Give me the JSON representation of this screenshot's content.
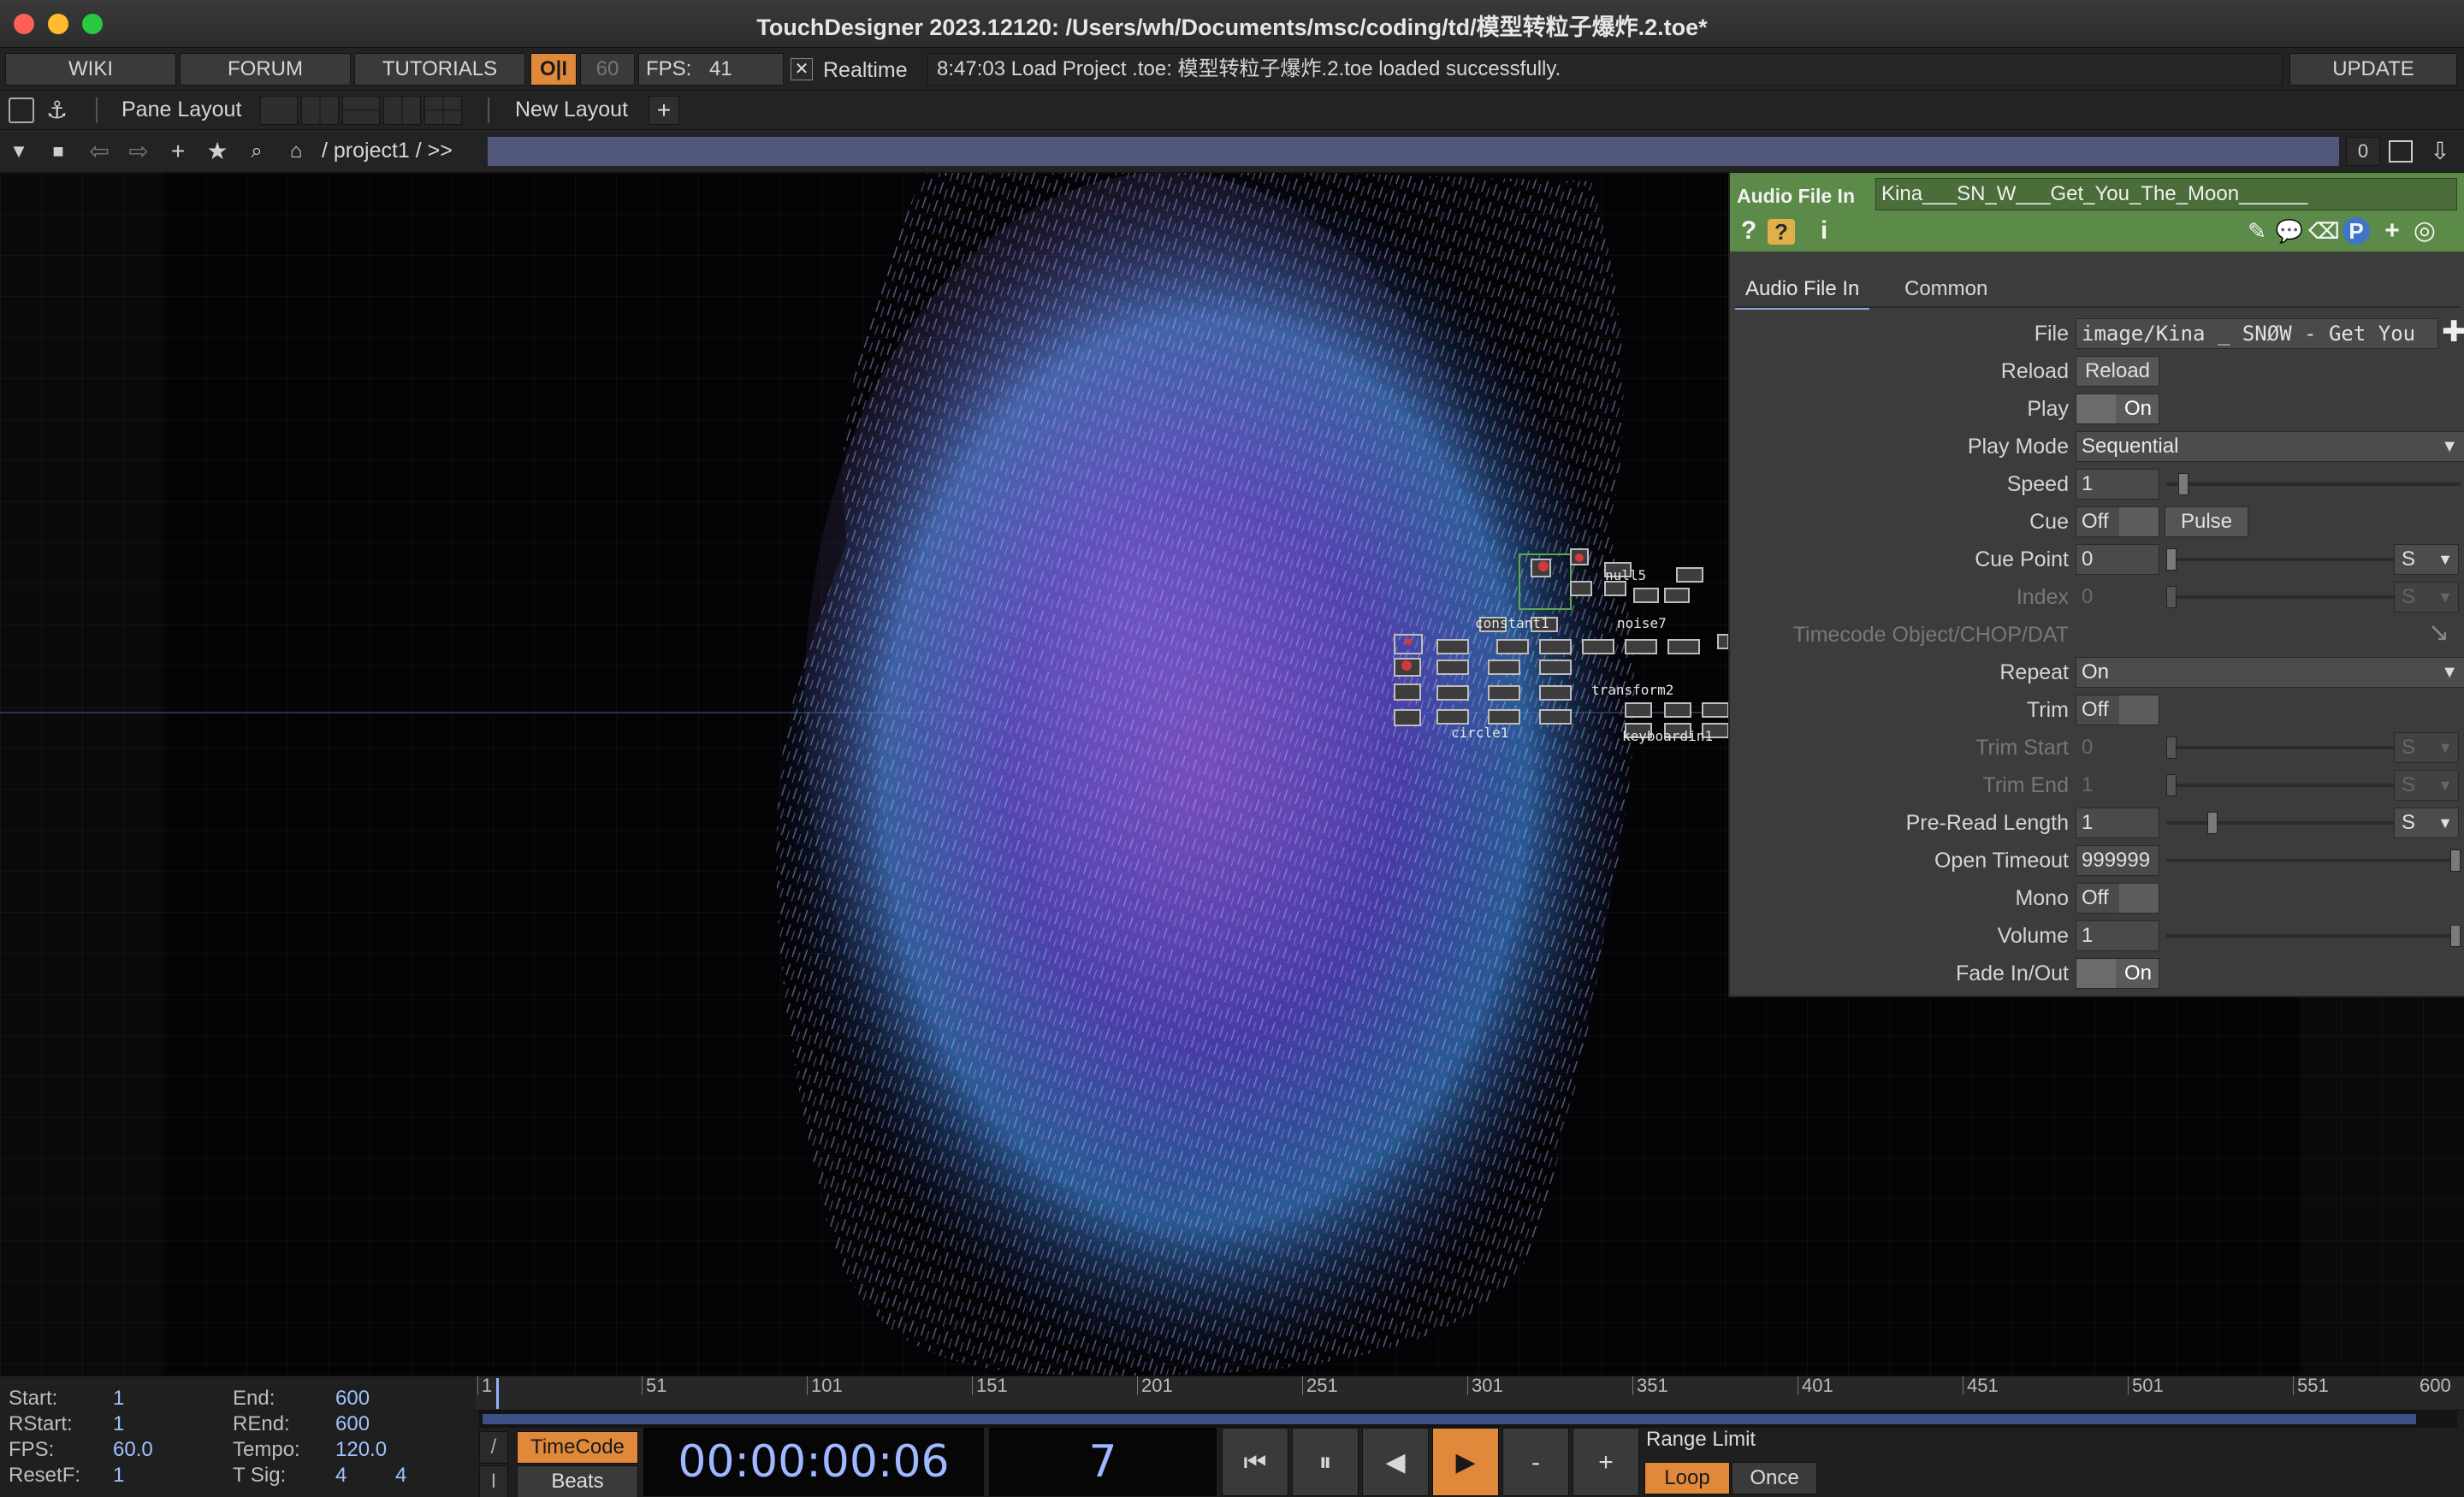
{
  "window": {
    "title": "TouchDesigner 2023.12120: /Users/wh/Documents/msc/coding/td/模型转粒子爆炸.2.toe*"
  },
  "menubar": {
    "wiki": "WIKI",
    "forum": "FORUM",
    "tutorials": "TUTORIALS",
    "oi_badge": "O|I",
    "fps_target": "60",
    "fps_label": "FPS:",
    "fps_value": "41",
    "realtime_check": "✕",
    "realtime_label": "Realtime",
    "status": "8:47:03 Load Project .toe: 模型转粒子爆炸.2.toe loaded successfully.",
    "update": "UPDATE"
  },
  "layoutbar": {
    "pane_layout": "Pane Layout",
    "new_layout": "New Layout",
    "add": "+"
  },
  "pathbar": {
    "path": "/ project1 / >>",
    "counter": "0"
  },
  "params": {
    "op_type": "Audio File In",
    "op_name": "Kina___SN_W___Get_You_The_Moon______",
    "tabs": [
      "Audio File In",
      "Common"
    ],
    "rows": {
      "file_label": "File",
      "file_value": "image/Kina _ SNØW - Get You",
      "reload_label": "Reload",
      "reload_btn": "Reload",
      "play_label": "Play",
      "play_value": "On",
      "playmode_label": "Play Mode",
      "playmode_value": "Sequential",
      "speed_label": "Speed",
      "speed_value": "1",
      "cue_label": "Cue",
      "cue_value": "Off",
      "pulse_btn": "Pulse",
      "cuepoint_label": "Cue Point",
      "cuepoint_value": "0",
      "cuepoint_unit": "S",
      "index_label": "Index",
      "index_value": "0",
      "index_unit": "S",
      "timecode_label": "Timecode Object/CHOP/DAT",
      "repeat_label": "Repeat",
      "repeat_value": "On",
      "trim_label": "Trim",
      "trim_value": "Off",
      "trimstart_label": "Trim Start",
      "trimstart_value": "0",
      "trimstart_unit": "S",
      "trimend_label": "Trim End",
      "trimend_value": "1",
      "trimend_unit": "S",
      "preread_label": "Pre-Read Length",
      "preread_value": "1",
      "preread_unit": "S",
      "timeout_label": "Open Timeout",
      "timeout_value": "999999",
      "mono_label": "Mono",
      "mono_value": "Off",
      "volume_label": "Volume",
      "volume_value": "1",
      "fade_label": "Fade In/Out",
      "fade_value": "On"
    }
  },
  "network_overlay": {
    "labels": [
      "constant1",
      "noise7",
      "transform2",
      "keyboardin1",
      "null5",
      "circle1"
    ]
  },
  "timeline": {
    "start_label": "Start:",
    "start": "1",
    "end_label": "End:",
    "end": "600",
    "rstart_label": "RStart:",
    "rstart": "1",
    "rend_label": "REnd:",
    "rend": "600",
    "fps_label": "FPS:",
    "fps": "60.0",
    "tempo_label": "Tempo:",
    "tempo": "120.0",
    "resetf_label": "ResetF:",
    "resetf": "1",
    "tsig_label": "T Sig:",
    "tsig_a": "4",
    "tsig_b": "4",
    "ticks": [
      "1",
      "51",
      "101",
      "151",
      "201",
      "251",
      "301",
      "351",
      "401",
      "451",
      "501",
      "551",
      "600"
    ],
    "timecode_btn": "TimeCode",
    "beats_btn": "Beats",
    "timecode": "00:00:00:06",
    "frame": "7",
    "range_limit": "Range Limit",
    "loop": "Loop",
    "once": "Once",
    "minus": "-",
    "plus": "+"
  },
  "colors": {
    "accent_orange": "#e0893a",
    "param_header_green": "#5c8a48",
    "timecode_blue": "#9fb8ff"
  }
}
